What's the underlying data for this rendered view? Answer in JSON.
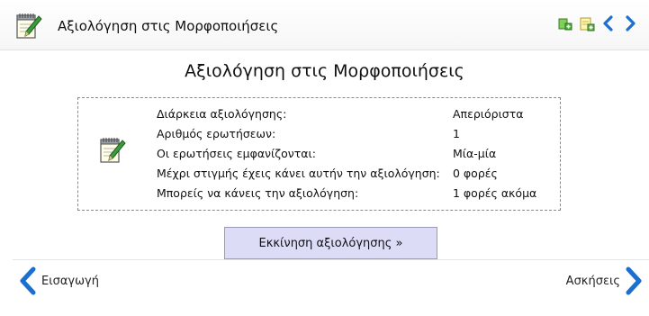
{
  "header": {
    "title": "Αξιολόγηση στις Μορφοποιήσεις",
    "icon": "notepad-pencil-icon",
    "tools": [
      {
        "name": "add-page-icon",
        "interactable": true
      },
      {
        "name": "edit-note-icon",
        "interactable": true
      },
      {
        "name": "chevron-left-icon",
        "interactable": true
      },
      {
        "name": "chevron-right-icon",
        "interactable": true
      }
    ]
  },
  "main": {
    "title": "Αξιολόγηση στις Μορφοποιήσεις",
    "icon": "notepad-pencil-icon",
    "rows": [
      {
        "label": "Διάρκεια αξιολόγησης:",
        "value": "Απεριόριστα"
      },
      {
        "label": "Αριθμός ερωτήσεων:",
        "value": "1"
      },
      {
        "label": "Οι ερωτήσεις εμφανίζονται:",
        "value": "Μία-μία"
      },
      {
        "label": "Μέχρι στιγμής έχεις κάνει αυτήν την αξιολόγηση:",
        "value": "0 φορές"
      },
      {
        "label": "Μπορείς να κάνεις την αξιολόγηση:",
        "value": "1 φορές ακόμα"
      }
    ],
    "start_button": "Εκκίνηση αξιολόγησης »"
  },
  "footer": {
    "prev_label": "Εισαγωγή",
    "next_label": "Ασκήσεις"
  },
  "colors": {
    "accent_blue": "#1a6fd0",
    "button_bg": "#dcdcf6"
  }
}
